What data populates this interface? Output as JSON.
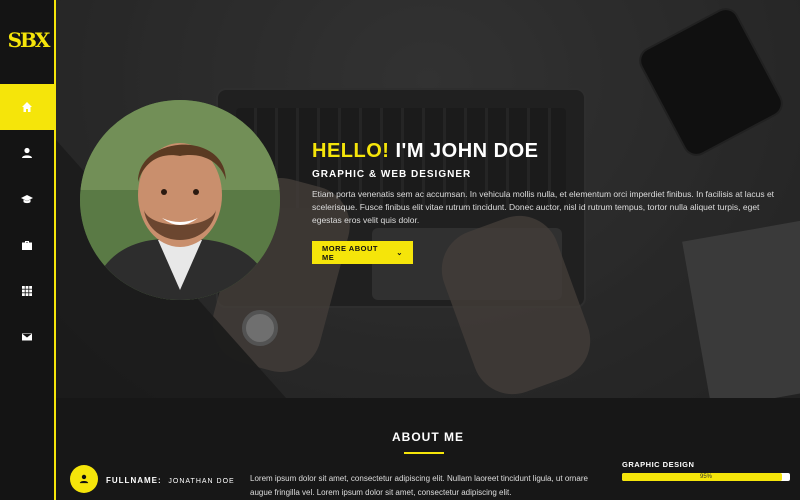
{
  "brand": {
    "logo_text": "SBX",
    "accent": "#f5e50a"
  },
  "sidebar": {
    "items": [
      {
        "icon": "home-icon",
        "active": true
      },
      {
        "icon": "user-icon",
        "active": false
      },
      {
        "icon": "graduation-cap-icon",
        "active": false
      },
      {
        "icon": "briefcase-icon",
        "active": false
      },
      {
        "icon": "grid-icon",
        "active": false
      },
      {
        "icon": "envelope-icon",
        "active": false
      }
    ]
  },
  "hero": {
    "greeting": "HELLO!",
    "name_line": "I'M JOHN DOE",
    "role": "GRAPHIC & WEB DESIGNER",
    "intro": "Etiam porta venenatis sem ac accumsan. In vehicula mollis nulla, et elementum orci imperdiet finibus. In facilisis at lacus et scelerisque. Fusce finibus elit vitae rutrum tincidunt. Donec auctor, nisl id rutrum tempus, tortor nulla aliquet turpis, eget egestas eros velit quis dolor.",
    "button_label": "MORE ABOUT ME",
    "button_icon": "chevron-down-icon"
  },
  "about": {
    "title": "ABOUT ME",
    "fullname_label": "FULLNAME:",
    "fullname_value": "JONATHAN DOE",
    "text": "Lorem ipsum dolor sit amet, consectetur adipiscing elit. Nullam laoreet tincidunt ligula, ut ornare augue fringilla vel. Lorem ipsum dolor sit amet, consectetur adipiscing elit.",
    "skill": {
      "label": "GRAPHIC DESIGN",
      "percent_label": "95%",
      "percent": 95
    }
  }
}
